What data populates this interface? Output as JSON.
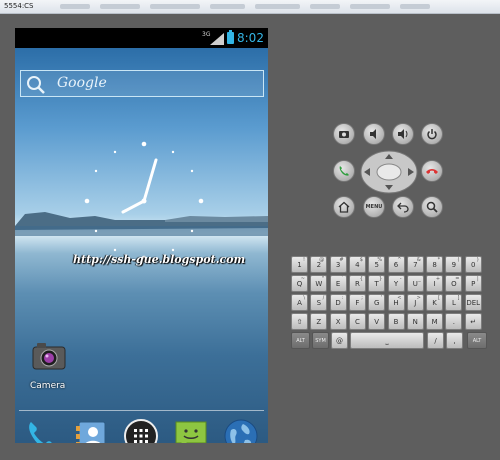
{
  "window": {
    "title": "5554:CS"
  },
  "status_bar": {
    "network": "3G",
    "time": "8:02"
  },
  "search": {
    "label": "Google"
  },
  "watermark": "http://ssh-gue.blogspot.com",
  "apps": {
    "camera_label": "Camera"
  },
  "keyboard": {
    "row1": [
      [
        "1",
        "!"
      ],
      [
        "2",
        "@"
      ],
      [
        "3",
        "#"
      ],
      [
        "4",
        "$"
      ],
      [
        "5",
        "%"
      ],
      [
        "6",
        "^"
      ],
      [
        "7",
        "&"
      ],
      [
        "8",
        "*"
      ],
      [
        "9",
        "("
      ],
      [
        "0",
        ")"
      ]
    ],
    "row2": [
      [
        "Q",
        "~"
      ],
      [
        "W",
        "\""
      ],
      [
        "E",
        "`"
      ],
      [
        "R",
        "{"
      ],
      [
        "T",
        "}"
      ],
      [
        "Y",
        "-"
      ],
      [
        "U",
        "_"
      ],
      [
        "I",
        "+"
      ],
      [
        "O",
        "="
      ],
      [
        "P",
        "|"
      ]
    ],
    "row3": [
      [
        "A",
        "\\"
      ],
      [
        "S",
        "/"
      ],
      [
        "D",
        ":"
      ],
      [
        "F",
        ";"
      ],
      [
        "G",
        "'"
      ],
      [
        "H",
        "<"
      ],
      [
        "J",
        ">"
      ],
      [
        "K",
        "["
      ],
      [
        "L",
        "]"
      ],
      [
        "DEL",
        ""
      ]
    ],
    "row4": [
      [
        "⇧",
        ""
      ],
      [
        "Z",
        ""
      ],
      [
        "X",
        ""
      ],
      [
        "C",
        ""
      ],
      [
        "V",
        ""
      ],
      [
        "B",
        ""
      ],
      [
        "N",
        ""
      ],
      [
        "M",
        ""
      ],
      [
        ".",
        ""
      ],
      [
        "↵",
        ""
      ]
    ],
    "row5": {
      "alt_left": "ALT",
      "sym": "SYM",
      "at": "@",
      "space": "⎵",
      "slash": "/",
      "comma": ",",
      "alt_right": "ALT"
    }
  },
  "colors": {
    "accent": "#33b5e5",
    "frame": "#5e5e5e"
  },
  "icons": {
    "controls": [
      "camera-icon",
      "volume-down-icon",
      "volume-up-icon",
      "power-icon",
      "call-icon",
      "end-call-icon",
      "home-icon",
      "menu-icon",
      "back-icon",
      "search-icon"
    ],
    "dock": [
      "phone-icon",
      "contacts-icon",
      "app-drawer-icon",
      "messaging-icon",
      "browser-icon"
    ]
  }
}
